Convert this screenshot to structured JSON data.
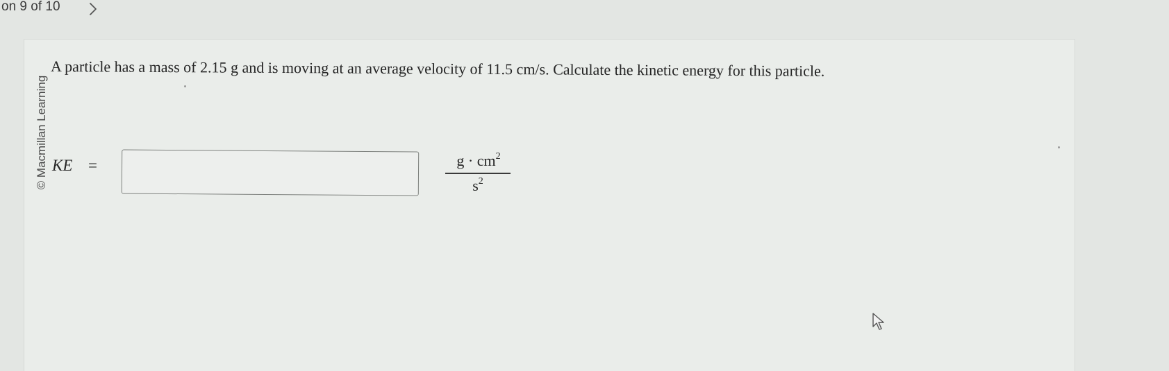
{
  "nav": {
    "question_counter": "on 9 of 10",
    "next_icon": "chevron-right-icon"
  },
  "card": {
    "copyright": "© Macmillan Learning",
    "question": "A particle has a mass of 2.15 g and is moving at an average velocity of 11.5 cm/s. Calculate the kinetic energy for this particle.",
    "answer_label": "KE",
    "equals": "=",
    "answer_value": "",
    "unit": {
      "numerator_base": "g · cm",
      "numerator_exp": "2",
      "denominator_base": "s",
      "denominator_exp": "2"
    }
  },
  "pointer": {
    "icon": "mouse-pointer-icon"
  },
  "colors": {
    "page_background": "#e3e6e3",
    "card_background": "#eaedea",
    "text": "#262626",
    "input_border": "#7d807d"
  }
}
